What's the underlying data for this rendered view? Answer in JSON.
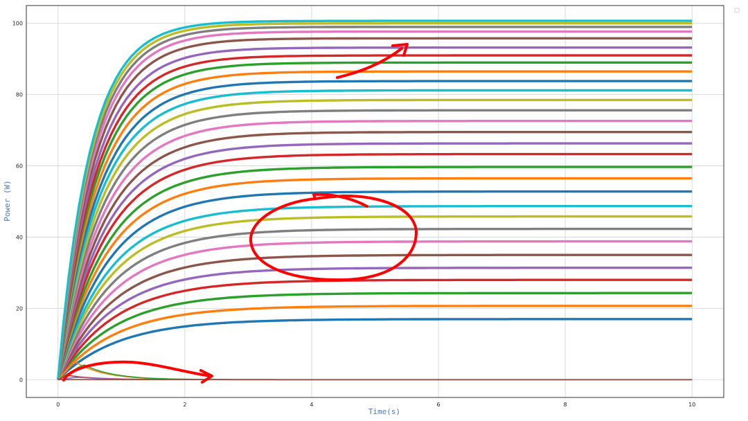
{
  "chart_data": {
    "type": "line",
    "xlabel": "Time(s)",
    "ylabel": "Power (W)",
    "xlim": [
      -0.5,
      10.5
    ],
    "ylim": [
      -5,
      105
    ],
    "x_ticks": [
      0,
      2,
      4,
      6,
      8,
      10
    ],
    "y_ticks": [
      0,
      20,
      40,
      60,
      80,
      100
    ],
    "grid": true,
    "legend": "top-right (empty)",
    "palette": [
      "#1f77b4",
      "#ff7f0e",
      "#2ca02c",
      "#d62728",
      "#9467bd",
      "#8c564b",
      "#e377c2",
      "#7f7f7f",
      "#bcbd22",
      "#17becf"
    ],
    "series_values": [
      17.0,
      20.7,
      24.3,
      28.0,
      31.4,
      35.0,
      38.8,
      42.3,
      45.8,
      48.7,
      52.8,
      56.5,
      59.7,
      63.3,
      66.3,
      69.5,
      72.6,
      75.6,
      78.5,
      81.2,
      83.8,
      86.5,
      89.0,
      91.0,
      93.2,
      95.8,
      97.7,
      99.0,
      100.0,
      100.7
    ],
    "zero_series": [
      {
        "peak_x": 0.25,
        "peak_y": 5.2
      },
      {
        "peak_x": 0.4,
        "peak_y": 4.3
      },
      {
        "peak_x": 0.15,
        "peak_y": 1.2
      },
      {
        "peak_x": 0.3,
        "peak_y": 0.7
      }
    ],
    "annotation_color": "#ff0000"
  }
}
